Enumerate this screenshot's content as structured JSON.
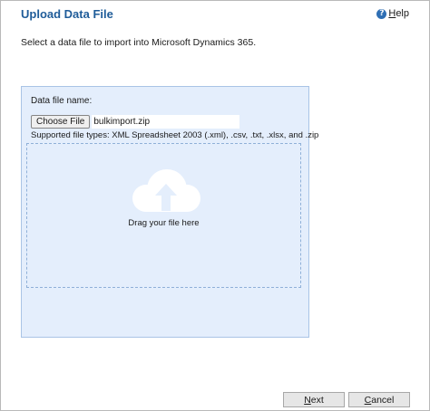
{
  "dialog": {
    "title": "Upload Data File",
    "help": {
      "accesskey_letter": "H",
      "rest": "elp"
    },
    "instruction": "Select a data file to import into Microsoft Dynamics 365."
  },
  "upload": {
    "field_label": "Data file name:",
    "choose_button": "Choose File",
    "selected_file": "bulkimport.zip",
    "supported_types": "Supported file types: XML Spreadsheet 2003 (.xml), .csv, .txt, .xlsx, and .zip",
    "drop_text": "Drag your file here"
  },
  "footer": {
    "next": {
      "accesskey_letter": "N",
      "rest": "ext"
    },
    "cancel": {
      "accesskey_letter": "C",
      "rest": "ancel"
    }
  },
  "colors": {
    "title": "#1f5c99",
    "panel_bg": "#e4eefc",
    "panel_border": "#a9c4e6",
    "dropzone_border": "#8fb0d8",
    "help_icon": "#2f6fb4"
  },
  "icons": {
    "help": "help-icon",
    "upload": "cloud-upload-icon"
  }
}
